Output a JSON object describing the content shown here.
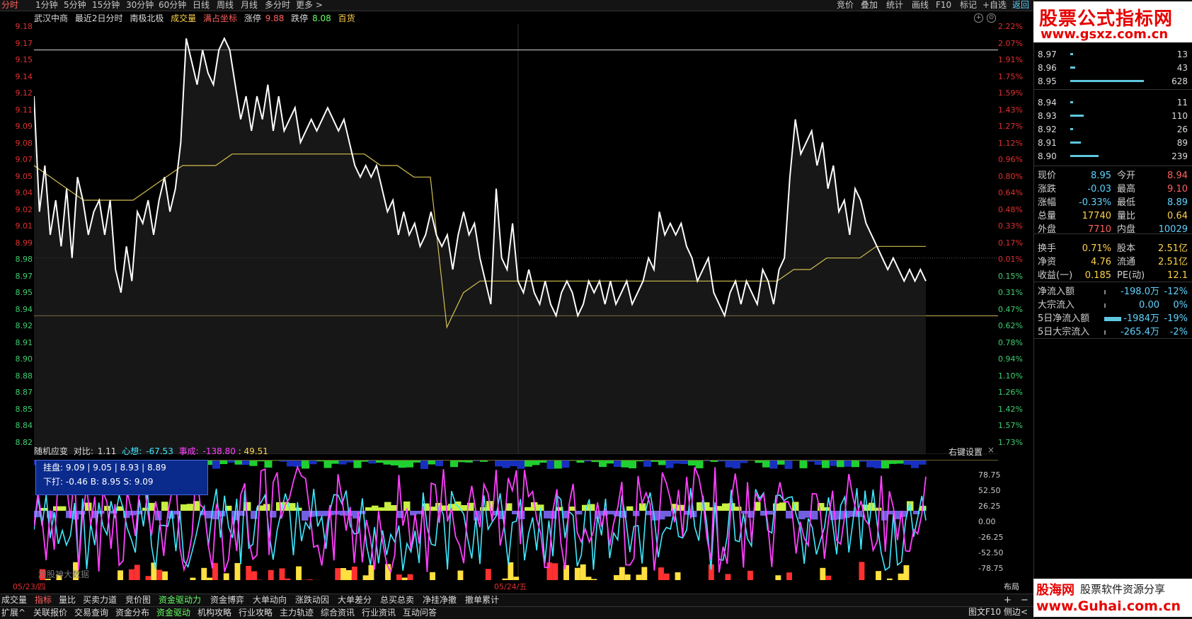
{
  "period_tabs": [
    "分时",
    "1分钟",
    "5分钟",
    "15分钟",
    "30分钟",
    "60分钟",
    "日线",
    "周线",
    "月线",
    "多分时",
    "更多 >"
  ],
  "tool_tabs": [
    "竞价",
    "叠加",
    "统计",
    "画线",
    "F10",
    "标记",
    "+自选",
    "返回"
  ],
  "info": {
    "name": "武汉中商",
    "mode": "最近2日分时",
    "extra": "南极北极",
    "volume_label": "成交量",
    "coord_label": "满占坐标",
    "limit_up_label": "涨停",
    "limit_up": "9.88",
    "limit_down_label": "跌停",
    "limit_down": "8.08",
    "source": "百货"
  },
  "price_ticks": [
    "9.18",
    "9.17",
    "9.15",
    "9.14",
    "9.12",
    "9.11",
    "9.09",
    "9.08",
    "9.07",
    "9.05",
    "9.04",
    "9.02",
    "9.01",
    "8.99",
    "8.98",
    "8.97",
    "8.95",
    "8.94",
    "8.92",
    "8.91",
    "8.90",
    "8.88",
    "8.87",
    "8.85",
    "8.84",
    "8.82"
  ],
  "pct_ticks": [
    "2.22%",
    "2.07%",
    "1.91%",
    "1.75%",
    "1.59%",
    "1.43%",
    "1.27%",
    "1.12%",
    "0.96%",
    "0.80%",
    "0.64%",
    "0.48%",
    "0.33%",
    "0.17%",
    "0.01%",
    "0.15%",
    "0.31%",
    "0.47%",
    "0.62%",
    "0.78%",
    "0.94%",
    "1.10%",
    "1.26%",
    "1.42%",
    "1.57%",
    "1.73%"
  ],
  "indicator": {
    "name": "随机应变",
    "ratio_label": "对比:",
    "ratio": "1.11",
    "mind_label": "心想:",
    "mind": "-67.53",
    "result_label": "事成:",
    "result": "-138.80",
    "extra": ": 49.51",
    "settings": "右键设置",
    "ticks": [
      "78.75",
      "52.50",
      "26.25",
      "0.00",
      "-26.25",
      "-52.50",
      "-78.75"
    ],
    "tooltip_line1": "挂盘: 9.09 | 9.05 | 8.93 | 8.89",
    "tooltip_line2": "下打: -0.46  B: 8.95  S: 9.09",
    "watermark": "旭股神大数据"
  },
  "dates": [
    "05/23/四",
    "05/24/五"
  ],
  "layout_label": "布局",
  "tabs_row1": [
    "成交量",
    "指标",
    "量比",
    "买卖力道",
    "竞价图",
    "资金驱动力",
    "资金博弈",
    "大单动向",
    "涨跌动因",
    "大单差分",
    "总买总卖",
    "净挂净撤",
    "撤单累计"
  ],
  "tabs_row2": [
    "扩展^",
    "关联报价",
    "交易查询",
    "资金分布",
    "资金驱动",
    "机构攻略",
    "行业攻略",
    "主力轨迹",
    "综合资讯",
    "行业资讯",
    "互动问答"
  ],
  "bottom_right": [
    "图文F10",
    "侧边<"
  ],
  "watermark_top": {
    "cn": "股票公式指标网",
    "url": "www.gsxz.com.cn"
  },
  "order_book": [
    {
      "price": "8.97",
      "vol": "13",
      "bar": 0.02
    },
    {
      "price": "8.96",
      "vol": "43",
      "bar": 0.07
    },
    {
      "price": "8.95",
      "vol": "628",
      "bar": 1.0
    },
    {
      "price": "8.94",
      "vol": "11",
      "bar": 0.02
    },
    {
      "price": "8.93",
      "vol": "110",
      "bar": 0.18
    },
    {
      "price": "8.92",
      "vol": "26",
      "bar": 0.04
    },
    {
      "price": "8.91",
      "vol": "89",
      "bar": 0.14
    },
    {
      "price": "8.90",
      "vol": "239",
      "bar": 0.38
    }
  ],
  "quote": [
    {
      "k1": "现价",
      "v1": "8.95",
      "c1": "#5fd3ff",
      "k2": "今开",
      "v2": "8.94",
      "c2": "#ff6060"
    },
    {
      "k1": "涨跌",
      "v1": "-0.03",
      "c1": "#5fd3ff",
      "k2": "最高",
      "v2": "9.10",
      "c2": "#ff6060"
    },
    {
      "k1": "涨幅",
      "v1": "-0.33%",
      "c1": "#5fd3ff",
      "k2": "最低",
      "v2": "8.89",
      "c2": "#5fd3ff"
    },
    {
      "k1": "总量",
      "v1": "17740",
      "c1": "#ffd24a",
      "k2": "量比",
      "v2": "0.64",
      "c2": "#ffd24a"
    },
    {
      "k1": "外盘",
      "v1": "7710",
      "c1": "#ff6060",
      "k2": "内盘",
      "v2": "10029",
      "c2": "#5fd3ff"
    },
    {
      "k1": "换手",
      "v1": "0.71%",
      "c1": "#ffd24a",
      "k2": "股本",
      "v2": "2.51亿",
      "c2": "#ffd24a"
    },
    {
      "k1": "净资",
      "v1": "4.76",
      "c1": "#ffd24a",
      "k2": "流通",
      "v2": "2.51亿",
      "c2": "#ffd24a"
    },
    {
      "k1": "收益(一)",
      "v1": "0.185",
      "c1": "#ffd24a",
      "k2": "PE(动)",
      "v2": "12.1",
      "c2": "#ffd24a"
    }
  ],
  "flows": [
    {
      "k": "净流入额",
      "v": "-198.0万",
      "p": "-12%",
      "bar": 0.0
    },
    {
      "k": "大宗流入",
      "v": "0.00",
      "p": "0%",
      "bar": 0.0
    },
    {
      "k": "5日净流入额",
      "v": "-1984万",
      "p": "-19%",
      "bar": 0.8
    },
    {
      "k": "5日大宗流入",
      "v": "-265.4万",
      "p": "-2%",
      "bar": 0.0
    }
  ],
  "watermark_bottom": {
    "a": "股海网",
    "b": "股票软件资源分享",
    "url": "www.Guhai.com.cn"
  },
  "colors": {
    "up": "#e03030",
    "down": "#5fd3ff",
    "price_line": "#ffffff",
    "avg_line": "#d4c050",
    "magenta": "#ff40ff",
    "cyan": "#40e8ff"
  },
  "chart_data": {
    "type": "line",
    "ylim": [
      8.82,
      9.18
    ],
    "prev_close": 8.98,
    "series": [
      {
        "values": [
          9.12,
          9.02,
          9.06,
          9.0,
          9.03,
          8.99,
          9.04,
          8.98,
          9.05,
          9.03,
          9.0,
          9.02,
          9.03,
          9.0,
          9.03,
          8.97,
          8.95,
          8.99,
          8.96,
          9.02,
          9.01,
          9.03,
          9.0,
          9.03,
          9.05,
          9.02,
          9.04,
          9.08,
          9.17,
          9.15,
          9.13,
          9.16,
          9.14,
          9.13,
          9.16,
          9.17,
          9.16,
          9.13,
          9.1,
          9.12,
          9.09,
          9.12,
          9.1,
          9.13,
          9.09,
          9.12,
          9.09,
          9.1,
          9.11,
          9.08,
          9.09,
          9.1,
          9.09,
          9.1,
          9.11,
          9.1,
          9.09,
          9.1,
          9.08,
          9.06,
          9.05,
          9.06,
          9.05,
          9.06,
          9.04,
          9.02,
          9.03,
          9.0,
          9.02,
          9.0,
          9.01,
          8.99,
          9.0,
          9.02,
          9.0,
          8.99,
          9.0,
          8.97,
          9.0,
          9.02,
          9.0,
          9.01,
          8.98,
          8.96,
          8.94,
          9.04,
          8.98,
          8.97,
          9.01,
          8.96,
          8.95,
          8.97,
          8.95,
          8.94,
          8.96,
          8.94,
          8.93,
          8.95,
          8.96,
          8.95,
          8.93,
          8.94,
          8.96,
          8.95,
          8.96,
          8.94,
          8.96,
          8.94,
          8.95,
          8.96,
          8.94,
          8.95,
          8.96,
          8.98,
          8.97,
          9.02,
          9.0,
          9.01,
          9.0,
          9.01,
          8.99,
          8.98,
          8.96,
          8.97,
          8.98,
          8.95,
          8.94,
          8.93,
          8.95,
          8.96,
          8.94,
          8.96,
          8.95,
          8.94,
          8.97,
          8.96,
          8.94,
          8.97,
          8.98,
          9.05,
          9.1,
          9.07,
          9.08,
          9.09,
          9.06,
          9.08,
          9.04,
          9.06,
          9.02,
          9.03,
          9.0,
          9.04,
          9.03,
          9.01,
          9.0,
          8.99,
          8.98,
          8.97,
          8.98,
          8.97,
          8.96,
          8.97,
          8.96,
          8.97,
          8.96
        ]
      },
      {
        "values": [
          9.06,
          9.05,
          9.04,
          9.03,
          9.03,
          9.03,
          9.03,
          9.04,
          9.05,
          9.06,
          9.06,
          9.06,
          9.07,
          9.07,
          9.07,
          9.07,
          9.07,
          9.07,
          9.07,
          9.07,
          9.07,
          9.06,
          9.06,
          9.05,
          9.05,
          8.92,
          8.95,
          8.96,
          8.96,
          8.96,
          8.96,
          8.96,
          8.96,
          8.96,
          8.96,
          8.96,
          8.96,
          8.96,
          8.96,
          8.96,
          8.96,
          8.96,
          8.96,
          8.96,
          8.96,
          8.96,
          8.97,
          8.97,
          8.98,
          8.98,
          8.98,
          8.99,
          8.99,
          8.99,
          8.99
        ]
      }
    ]
  }
}
